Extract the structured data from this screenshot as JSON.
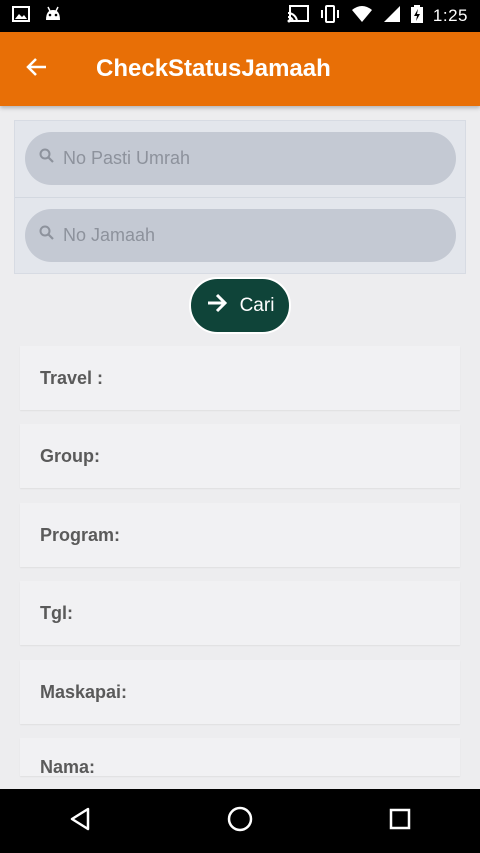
{
  "status_bar": {
    "time": "1:25"
  },
  "app_bar": {
    "title": "CheckStatusJamaah"
  },
  "search": {
    "no_pasti_umrah_placeholder": "No Pasti Umrah",
    "no_jamaah_placeholder": "No Jamaah"
  },
  "cari_button": {
    "label": "Cari"
  },
  "info_fields": [
    {
      "label": "Travel :"
    },
    {
      "label": "Group:"
    },
    {
      "label": "Program:"
    },
    {
      "label": "Tgl:"
    },
    {
      "label": "Maskapai:"
    },
    {
      "label": "Nama:"
    }
  ],
  "colors": {
    "app_bar": "#e86f06",
    "button": "#0f4439",
    "search_field": "#c4c9d3",
    "background": "#ededef"
  },
  "icons": [
    "image-icon",
    "android-icon",
    "cast-icon",
    "vibrate-icon",
    "wifi-icon",
    "signal-icon",
    "battery-icon",
    "back-arrow-icon",
    "search-icon",
    "arrow-right-icon",
    "nav-back-icon",
    "nav-home-icon",
    "nav-recents-icon"
  ]
}
